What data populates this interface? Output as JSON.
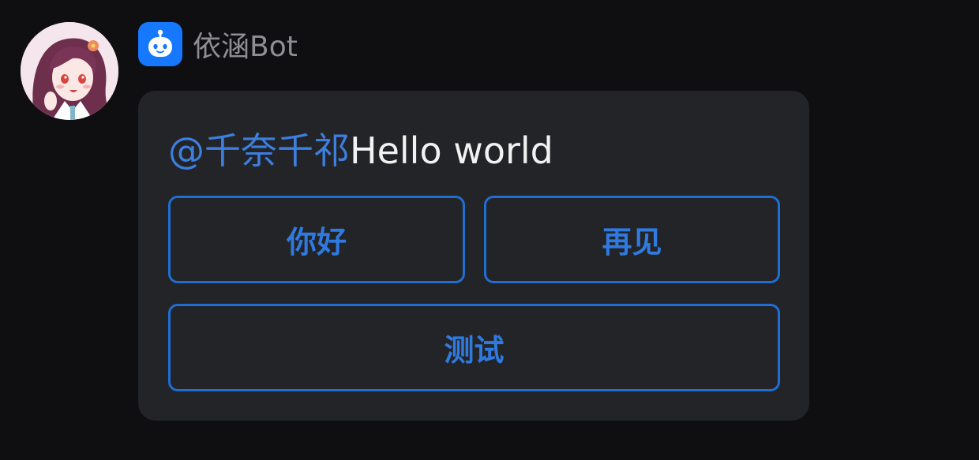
{
  "bot": {
    "name": "依涵Bot",
    "badge_icon": "robot-icon",
    "badge_color": "#1677ff"
  },
  "user": {
    "avatar_icon": "user-avatar"
  },
  "message": {
    "mention": "@千奈千祁",
    "text": "Hello world",
    "mention_color": "#3d7fe0"
  },
  "buttons": [
    {
      "label": "你好"
    },
    {
      "label": "再见"
    },
    {
      "label": "测试"
    }
  ],
  "colors": {
    "background": "#0f0f11",
    "card": "#232427",
    "button_border": "#1f6ed4",
    "button_text": "#2f7ae0"
  }
}
